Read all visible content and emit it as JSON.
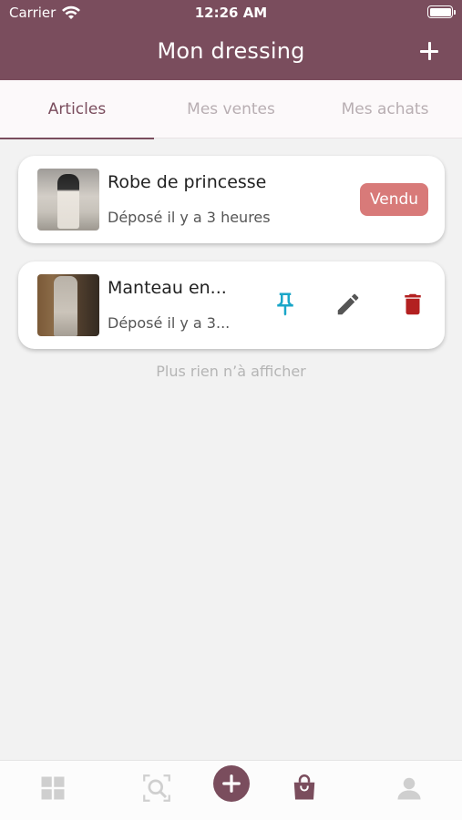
{
  "status_bar": {
    "carrier": "Carrier",
    "time": "12:26 AM"
  },
  "header": {
    "title": "Mon dressing",
    "add_icon": "plus-icon"
  },
  "tabs": [
    {
      "label": "Articles",
      "active": true
    },
    {
      "label": "Mes ventes",
      "active": false
    },
    {
      "label": "Mes achats",
      "active": false
    }
  ],
  "items": [
    {
      "title": "Robe de princesse",
      "subtitle": "Déposé il y a 3 heures",
      "badge": "Vendu"
    },
    {
      "title": "Manteau en...",
      "subtitle": "Déposé il y a 3...",
      "actions": [
        "pin-icon",
        "edit-icon",
        "trash-icon"
      ]
    }
  ],
  "empty_message": "Plus rien n’à afficher",
  "bottom_nav": [
    "grid-icon",
    "search-icon",
    "plus-icon",
    "shopping-bag-icon",
    "user-icon"
  ],
  "colors": {
    "primary": "#7a4d5d",
    "badge": "#d87a79",
    "pin": "#1aa6c8",
    "edit": "#555555",
    "trash": "#b32020"
  }
}
